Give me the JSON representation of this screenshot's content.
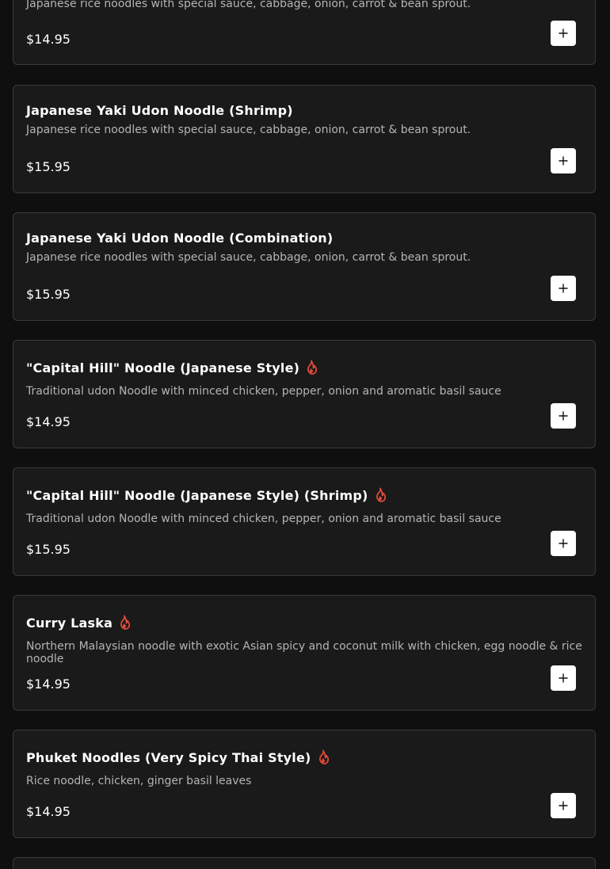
{
  "colors": {
    "background": "#0f0f0f",
    "card": "#1a1a1a",
    "card_border": "#3a3a3a",
    "spicy": "#e04a3a",
    "button": "#ffffff"
  },
  "items": [
    {
      "title": "",
      "description": "Japanese rice noodles with special sauce, cabbage, onion, carrot & bean sprout.",
      "price": "$14.95",
      "spicy": false,
      "add_icon": "plus-icon"
    },
    {
      "title": "Japanese Yaki Udon Noodle (Shrimp)",
      "description": "Japanese rice noodles with special sauce, cabbage, onion, carrot & bean sprout.",
      "price": "$15.95",
      "spicy": false,
      "add_icon": "plus-icon"
    },
    {
      "title": "Japanese Yaki Udon Noodle (Combination)",
      "description": "Japanese rice noodles with special sauce, cabbage, onion, carrot & bean sprout.",
      "price": "$15.95",
      "spicy": false,
      "add_icon": "plus-icon"
    },
    {
      "title": "\"Capital Hill\" Noodle (Japanese Style)",
      "description": "Traditional udon Noodle with minced chicken, pepper, onion and aromatic basil sauce",
      "price": "$14.95",
      "spicy": true,
      "add_icon": "plus-icon"
    },
    {
      "title": "\"Capital Hill\" Noodle (Japanese Style) (Shrimp)",
      "description": "Traditional udon Noodle with minced chicken, pepper, onion and aromatic basil sauce",
      "price": "$15.95",
      "spicy": true,
      "add_icon": "plus-icon"
    },
    {
      "title": "Curry Laska",
      "description": "Northern Malaysian noodle with exotic Asian spicy and coconut milk with chicken, egg noodle & rice noodle",
      "price": "$14.95",
      "spicy": true,
      "add_icon": "plus-icon"
    },
    {
      "title": "Phuket Noodles (Very Spicy Thai Style)",
      "description": "Rice noodle, chicken, ginger basil leaves",
      "price": "$14.95",
      "spicy": true,
      "add_icon": "plus-icon"
    }
  ]
}
